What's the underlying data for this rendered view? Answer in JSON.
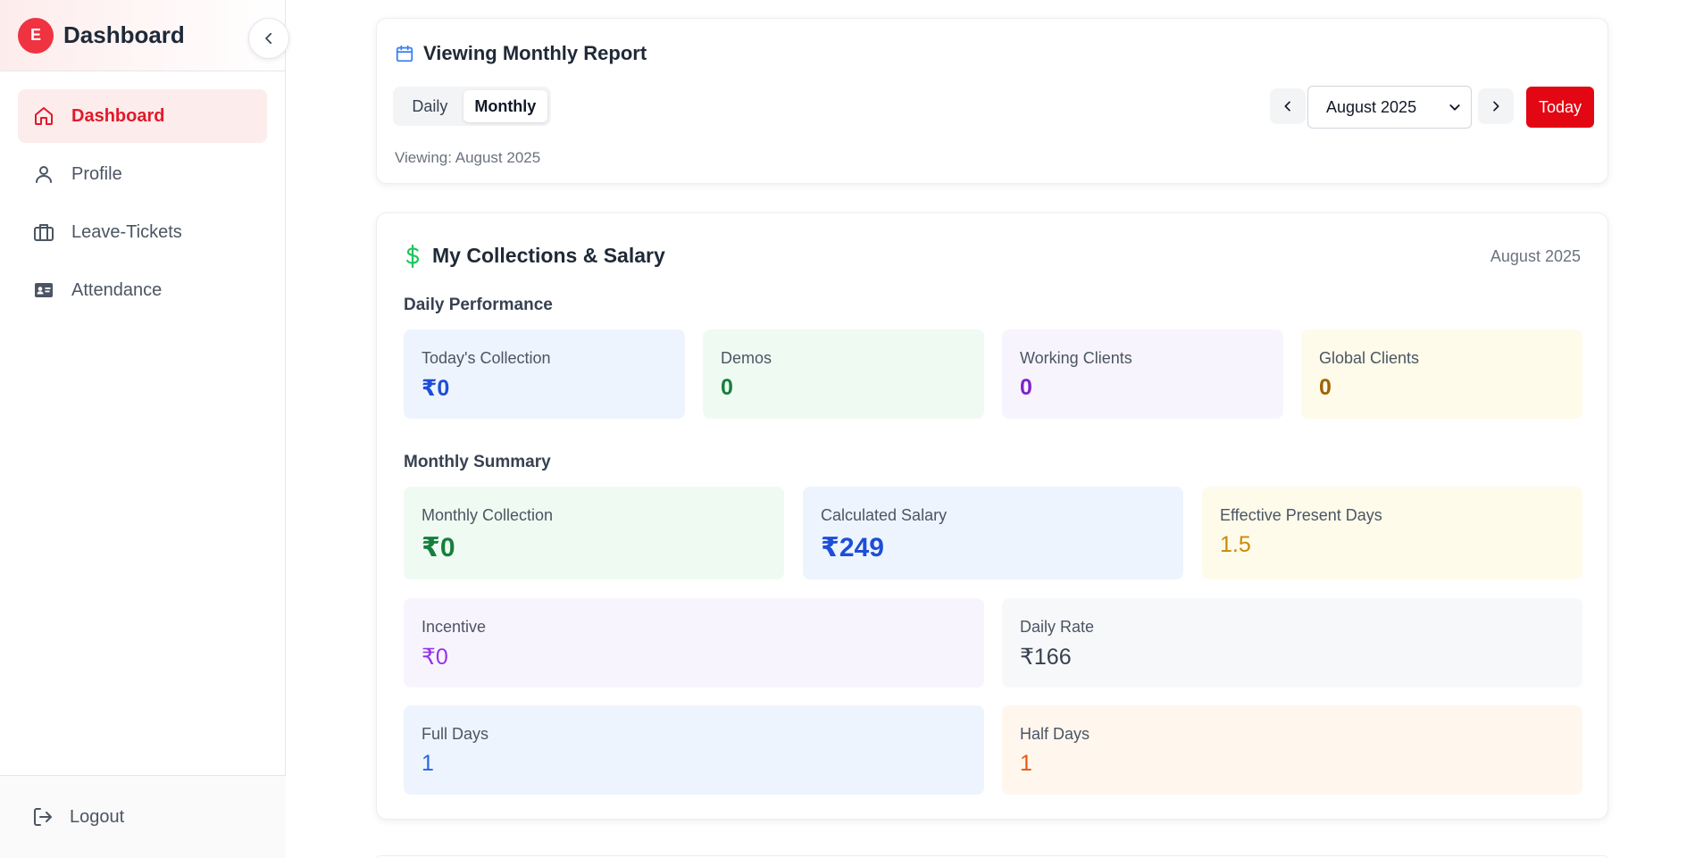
{
  "sidebar": {
    "logo_letter": "E",
    "brand": "Dashboard",
    "items": [
      {
        "label": "Dashboard",
        "icon": "home-icon",
        "active": true
      },
      {
        "label": "Profile",
        "icon": "user-icon"
      },
      {
        "label": "Leave-Tickets",
        "icon": "briefcase-icon"
      },
      {
        "label": "Attendance",
        "icon": "id-card-icon"
      }
    ],
    "logout_label": "Logout"
  },
  "report": {
    "title": "Viewing Monthly Report",
    "toggle": {
      "daily": "Daily",
      "monthly": "Monthly",
      "selected": "Monthly"
    },
    "viewing_text": "Viewing: August 2025",
    "month_value": "August 2025",
    "today_label": "Today"
  },
  "collections": {
    "title": "My Collections & Salary",
    "month": "August 2025",
    "daily_heading": "Daily Performance",
    "daily": [
      {
        "label": "Today's Collection",
        "value": "₹0",
        "color": "#1d4ed8"
      },
      {
        "label": "Demos",
        "value": "0",
        "color": "#15803d"
      },
      {
        "label": "Working Clients",
        "value": "0",
        "color": "#7e22ce"
      },
      {
        "label": "Global Clients",
        "value": "0",
        "color": "#a16207"
      }
    ],
    "monthly_heading": "Monthly Summary",
    "monthly": [
      {
        "label": "Monthly Collection",
        "value": "₹0",
        "color": "#15803d"
      },
      {
        "label": "Calculated Salary",
        "value": "₹249",
        "color": "#1d4ed8"
      },
      {
        "label": "Effective Present Days",
        "value": "1.5",
        "color": "#ca8a04"
      },
      {
        "label": "Incentive",
        "value": "₹0",
        "color": "#9333ea"
      },
      {
        "label": "Daily Rate",
        "value": "₹166",
        "color": "#374151"
      },
      {
        "label": "Full Days",
        "value": "1",
        "color": "#2563eb"
      },
      {
        "label": "Half Days",
        "value": "1",
        "color": "#ea580c"
      }
    ]
  },
  "colors": {
    "accent": "#e30613",
    "active_nav_bg": "#fdecec",
    "active_nav_text": "#e01a2b"
  }
}
